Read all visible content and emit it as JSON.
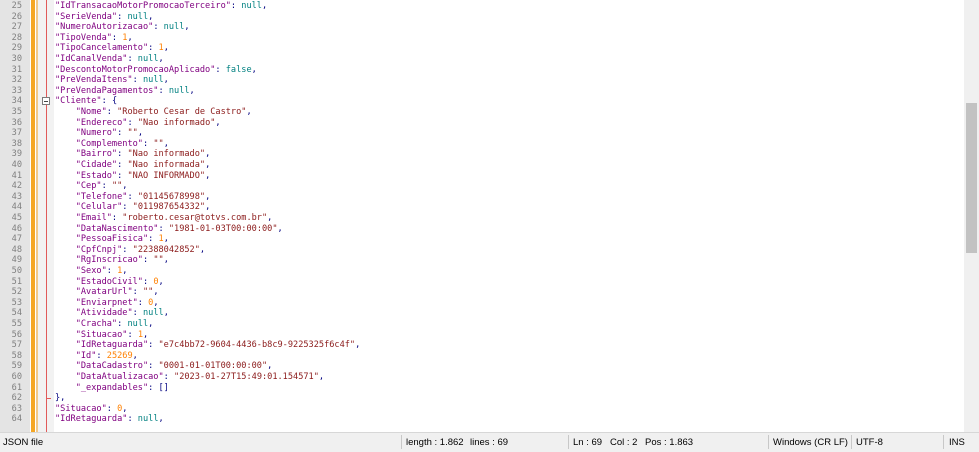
{
  "editor": {
    "lines": [
      {
        "no": "25",
        "text": "\"IdTransacaoMotorPromocaoTerceiro\": null,",
        "indent": 0,
        "key": "IdTransacaoMotorPromocaoTerceiro",
        "value": "null",
        "vtype": "kw"
      },
      {
        "no": "26",
        "indent": 0,
        "key": "SerieVenda",
        "value": "null",
        "vtype": "kw"
      },
      {
        "no": "27",
        "indent": 0,
        "key": "NumeroAutorizacao",
        "value": "null",
        "vtype": "kw"
      },
      {
        "no": "28",
        "indent": 0,
        "key": "TipoVenda",
        "value": "1",
        "vtype": "n"
      },
      {
        "no": "29",
        "indent": 0,
        "key": "TipoCancelamento",
        "value": "1",
        "vtype": "n"
      },
      {
        "no": "30",
        "indent": 0,
        "key": "IdCanalVenda",
        "value": "null",
        "vtype": "kw"
      },
      {
        "no": "31",
        "indent": 0,
        "key": "DescontoMotorPromocaoAplicado",
        "value": "false",
        "vtype": "kw"
      },
      {
        "no": "32",
        "indent": 0,
        "key": "PreVendaItens",
        "value": "null",
        "vtype": "kw"
      },
      {
        "no": "33",
        "indent": 0,
        "key": "PreVendaPagamentos",
        "value": "null",
        "vtype": "kw"
      },
      {
        "no": "34",
        "indent": 0,
        "key": "Cliente",
        "value": "{",
        "vtype": "p",
        "fold": "open"
      },
      {
        "no": "35",
        "indent": 1,
        "key": "Nome",
        "value": "\"Roberto Cesar de Castro\"",
        "vtype": "s"
      },
      {
        "no": "36",
        "indent": 1,
        "key": "Endereco",
        "value": "\"Nao informado\"",
        "vtype": "s"
      },
      {
        "no": "37",
        "indent": 1,
        "key": "Numero",
        "value": "\"\"",
        "vtype": "s"
      },
      {
        "no": "38",
        "indent": 1,
        "key": "Complemento",
        "value": "\"\"",
        "vtype": "s"
      },
      {
        "no": "39",
        "indent": 1,
        "key": "Bairro",
        "value": "\"Nao informado\"",
        "vtype": "s"
      },
      {
        "no": "40",
        "indent": 1,
        "key": "Cidade",
        "value": "\"Nao informada\"",
        "vtype": "s"
      },
      {
        "no": "41",
        "indent": 1,
        "key": "Estado",
        "value": "\"NAO INFORMADO\"",
        "vtype": "s"
      },
      {
        "no": "42",
        "indent": 1,
        "key": "Cep",
        "value": "\"\"",
        "vtype": "s"
      },
      {
        "no": "43",
        "indent": 1,
        "key": "Telefone",
        "value": "\"01145678998\"",
        "vtype": "s"
      },
      {
        "no": "44",
        "indent": 1,
        "key": "Celular",
        "value": "\"011987654332\"",
        "vtype": "s"
      },
      {
        "no": "45",
        "indent": 1,
        "key": "Email",
        "value": "\"roberto.cesar@totvs.com.br\"",
        "vtype": "s"
      },
      {
        "no": "46",
        "indent": 1,
        "key": "DataNascimento",
        "value": "\"1981-01-03T00:00:00\"",
        "vtype": "s"
      },
      {
        "no": "47",
        "indent": 1,
        "key": "PessoaFisica",
        "value": "1",
        "vtype": "n"
      },
      {
        "no": "48",
        "indent": 1,
        "key": "CpfCnpj",
        "value": "\"22388042852\"",
        "vtype": "s"
      },
      {
        "no": "49",
        "indent": 1,
        "key": "RgInscricao",
        "value": "\"\"",
        "vtype": "s"
      },
      {
        "no": "50",
        "indent": 1,
        "key": "Sexo",
        "value": "1",
        "vtype": "n"
      },
      {
        "no": "51",
        "indent": 1,
        "key": "EstadoCivil",
        "value": "0",
        "vtype": "n"
      },
      {
        "no": "52",
        "indent": 1,
        "key": "AvatarUrl",
        "value": "\"\"",
        "vtype": "s"
      },
      {
        "no": "53",
        "indent": 1,
        "key": "Enviarpnet",
        "value": "0",
        "vtype": "n"
      },
      {
        "no": "54",
        "indent": 1,
        "key": "Atividade",
        "value": "null",
        "vtype": "kw"
      },
      {
        "no": "55",
        "indent": 1,
        "key": "Cracha",
        "value": "null",
        "vtype": "kw"
      },
      {
        "no": "56",
        "indent": 1,
        "key": "Situacao",
        "value": "1",
        "vtype": "n"
      },
      {
        "no": "57",
        "indent": 1,
        "key": "IdRetaguarda",
        "value": "\"e7c4bb72-9604-4436-b8c9-9225325f6c4f\"",
        "vtype": "s"
      },
      {
        "no": "58",
        "indent": 1,
        "key": "Id",
        "value": "25269",
        "vtype": "n"
      },
      {
        "no": "59",
        "indent": 1,
        "key": "DataCadastro",
        "value": "\"0001-01-01T00:00:00\"",
        "vtype": "s"
      },
      {
        "no": "60",
        "indent": 1,
        "key": "DataAtualizacao",
        "value": "\"2023-01-27T15:49:01.154571\"",
        "vtype": "s"
      },
      {
        "no": "61",
        "indent": 1,
        "key": "_expandables",
        "value": "[]",
        "vtype": "p",
        "last": true
      },
      {
        "no": "62",
        "indent": 0,
        "raw": "},",
        "fold": "end"
      },
      {
        "no": "63",
        "indent": 0,
        "key": "Situacao",
        "value": "0",
        "vtype": "n"
      },
      {
        "no": "64",
        "indent": 0,
        "key": "IdRetaguarda",
        "value": "null",
        "vtype": "kw"
      }
    ]
  },
  "status": {
    "file_type": "JSON file",
    "length": "length : 1.862",
    "lines": "lines : 69",
    "ln": "Ln : 69",
    "col": "Col : 2",
    "pos": "Pos : 1.863",
    "eol": "Windows (CR LF)",
    "encoding": "UTF-8",
    "mode": "INS"
  },
  "colors": {
    "key": "#800080",
    "string": "#8b1a1a",
    "number": "#ff8000",
    "keyword": "#008080"
  }
}
